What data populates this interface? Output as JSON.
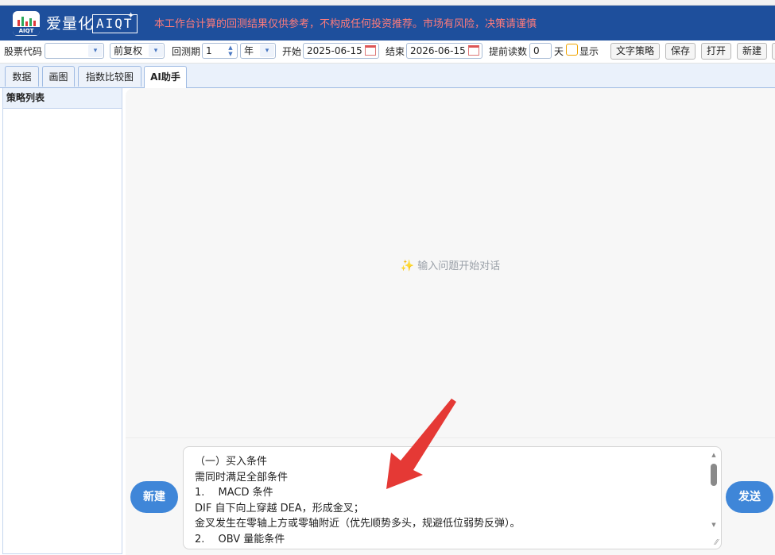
{
  "header": {
    "brand_name": "爱量化",
    "brand_mark": "AIQT",
    "logo_text": "AIQT",
    "disclaimer": "本工作台计算的回测结果仅供参考，不构成任何投资推荐。市场有风险，决策请谨慎"
  },
  "toolbar": {
    "stock_code_label": "股票代码",
    "stock_code_value": "",
    "adjust_value": "前复权",
    "period_label": "回测期",
    "period_value": "1",
    "period_unit": "年",
    "start_label": "开始",
    "start_date": "2025-06-15",
    "end_label": "结束",
    "end_date": "2026-06-15",
    "preload_label": "提前读数",
    "preload_value": "0",
    "preload_unit": "天",
    "show_label": "显示",
    "text_strategy_btn": "文字策略",
    "save_btn": "保存",
    "open_btn": "打开",
    "new_btn": "新建"
  },
  "tabs": [
    {
      "label": "数据"
    },
    {
      "label": "画图"
    },
    {
      "label": "指数比较图"
    },
    {
      "label": "AI助手"
    }
  ],
  "sidebar": {
    "title": "策略列表"
  },
  "chat": {
    "empty_hint": "输入问题开始对话",
    "new_button": "新建",
    "send_button": "发送",
    "input_lines": [
      "（一）买入条件",
      "需同时满足全部条件",
      "1.　 MACD 条件",
      "DIF 自下向上穿越 DEA，形成金叉；",
      "金叉发生在零轴上方或零轴附近（优先顺势多头，规避低位弱势反弹）。",
      "2.　 OBV 量能条件"
    ]
  },
  "colors": {
    "header_bg": "#1e4f9c",
    "disclaimer": "#ff7b7b",
    "accent_button": "#3f86d8",
    "annotation_arrow": "#e53935"
  }
}
